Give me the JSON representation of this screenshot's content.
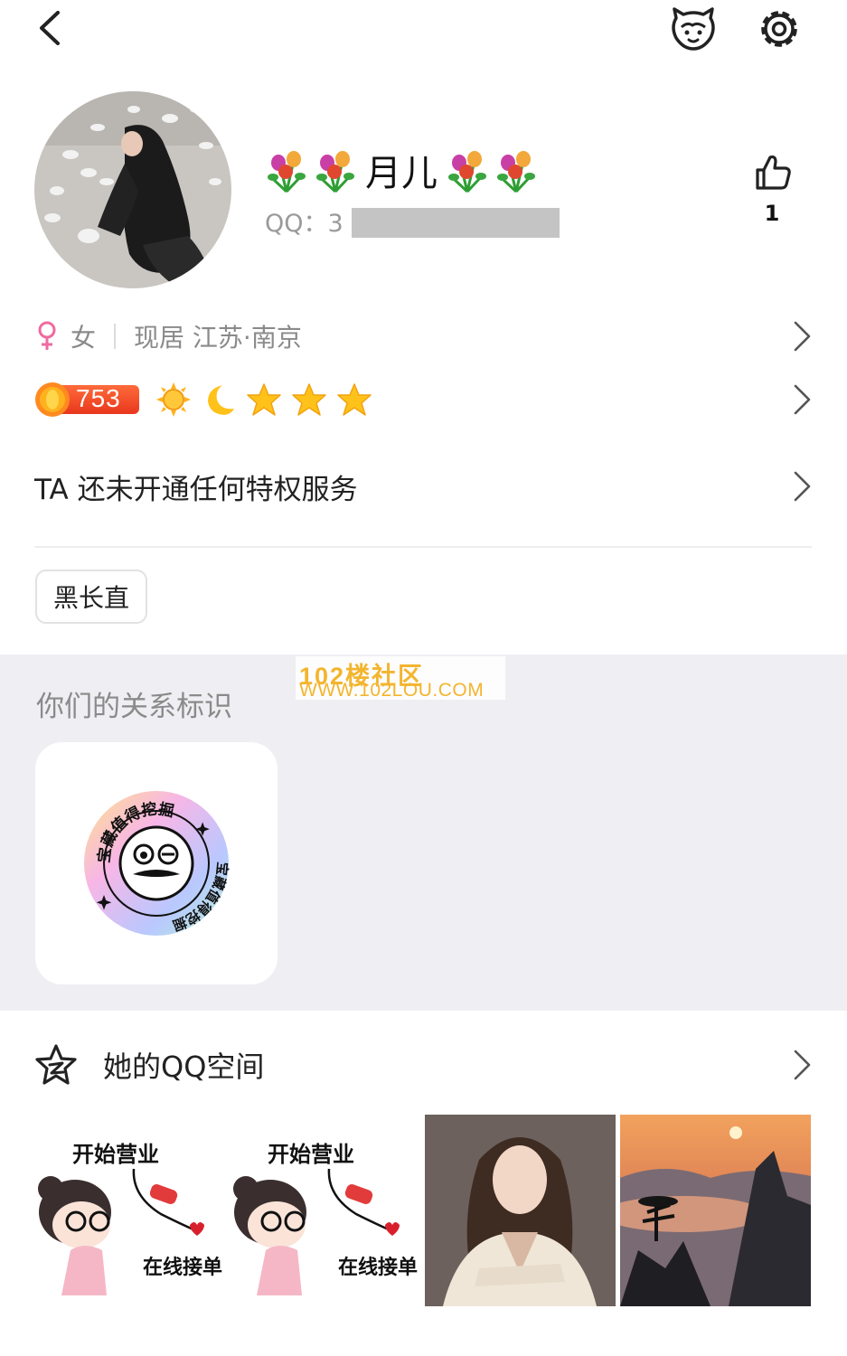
{
  "profile": {
    "nickname": "月儿",
    "qq_prefix": "QQ：3",
    "like_count": "1",
    "gender": "女",
    "location": "现居 江苏·南京",
    "level": "753",
    "level_icons": [
      "sun-icon",
      "moon-icon",
      "star-icon",
      "star-icon",
      "star-icon"
    ],
    "privilege_text": "TA 还未开通任何特权服务",
    "tag": "黑长直"
  },
  "relationship": {
    "title": "你们的关系标识",
    "badge_text_top": "宝藏值得挖掘",
    "badge_text_bottom": "宝藏值得挖掘"
  },
  "watermark": {
    "line1": "102楼社区",
    "line2": "WWW.102LOU.COM"
  },
  "qzone": {
    "title": "她的QQ空间",
    "photos": [
      {
        "top_text": "开始营业",
        "bottom_text": "在线接单"
      },
      {
        "top_text": "开始营业",
        "bottom_text": "在线接单"
      },
      {},
      {}
    ]
  },
  "colors": {
    "accent_level": "#e8371d",
    "gray_bg": "#efeff3",
    "muted_text": "#8a8a8a",
    "female_pink": "#f06aa0",
    "star_yellow": "#ffc21a",
    "watermark": "#f3b52e"
  }
}
